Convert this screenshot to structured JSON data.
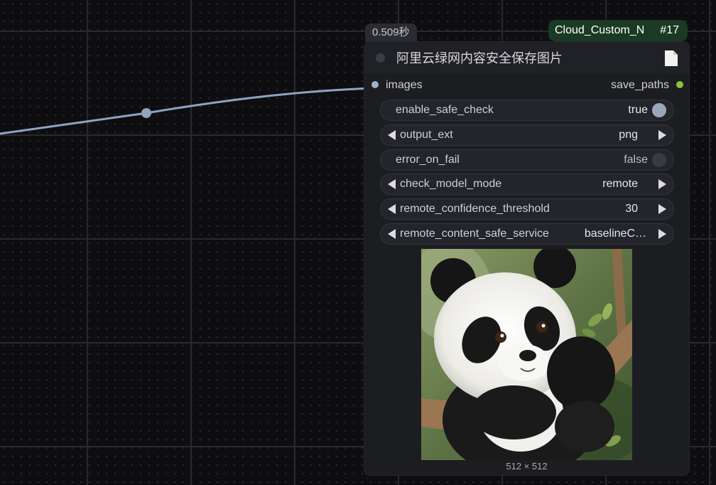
{
  "execution_time": "0.509秒",
  "badge": {
    "name": "Cloud_Custom_N",
    "id": "#17"
  },
  "node": {
    "title": "阿里云绿网内容安全保存图片",
    "input": {
      "label": "images"
    },
    "output": {
      "label": "save_paths"
    },
    "widgets": [
      {
        "name": "enable_safe_check",
        "value": "true",
        "kind": "toggle",
        "on": true
      },
      {
        "name": "output_ext",
        "value": "png",
        "kind": "combo"
      },
      {
        "name": "error_on_fail",
        "value": "false",
        "kind": "toggle",
        "on": false
      },
      {
        "name": "check_model_mode",
        "value": "remote",
        "kind": "combo"
      },
      {
        "name": "remote_confidence_threshold",
        "value": "30",
        "kind": "number"
      },
      {
        "name": "remote_content_safe_service",
        "value": "baselineC…",
        "kind": "combo"
      }
    ],
    "preview": {
      "dimensions": "512 × 512",
      "subject": "panda cub on a branch"
    }
  },
  "colors": {
    "link_wire": "#8ea3c0",
    "output_slot": "#8fbf3f",
    "badge_bg": "#1b3a26"
  }
}
